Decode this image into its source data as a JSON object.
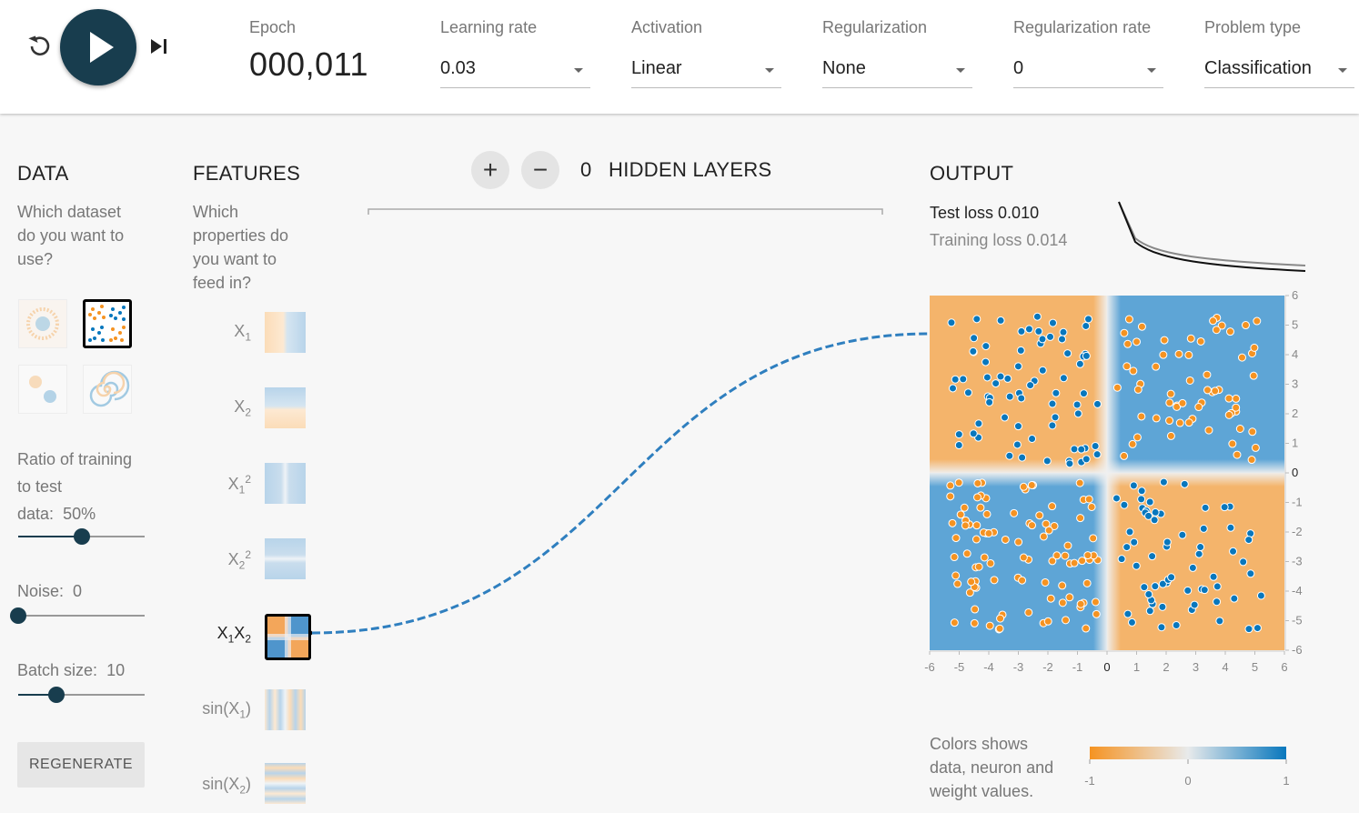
{
  "header": {
    "epoch_label": "Epoch",
    "epoch_value": "000,011",
    "controls": [
      {
        "label": "Learning rate",
        "value": "0.03"
      },
      {
        "label": "Activation",
        "value": "Linear"
      },
      {
        "label": "Regularization",
        "value": "None"
      },
      {
        "label": "Regularization rate",
        "value": "0"
      },
      {
        "label": "Problem type",
        "value": "Classification"
      }
    ]
  },
  "data_panel": {
    "title": "DATA",
    "question": [
      "Which dataset",
      "do you want to",
      "use?"
    ],
    "datasets": [
      "circle",
      "xor",
      "gaussian",
      "spiral"
    ],
    "selected_dataset": "xor",
    "ratio_label": [
      "Ratio of training",
      "to test"
    ],
    "ratio_prefix": "data:",
    "ratio_value": "50%",
    "ratio_fraction": 0.5,
    "noise_label": "Noise:",
    "noise_value": "0",
    "noise_fraction": 0,
    "batch_label": "Batch size:",
    "batch_value": "10",
    "batch_fraction": 0.3,
    "regenerate": "REGENERATE"
  },
  "features_panel": {
    "title": "FEATURES",
    "question": [
      "Which",
      "properties do",
      "you want to",
      "feed in?"
    ],
    "features": [
      {
        "id": "x1",
        "active": false
      },
      {
        "id": "x2",
        "active": false
      },
      {
        "id": "x1sq",
        "active": false
      },
      {
        "id": "x2sq",
        "active": false
      },
      {
        "id": "x1x2",
        "active": true
      },
      {
        "id": "sinx1",
        "active": false
      },
      {
        "id": "sinx2",
        "active": false
      }
    ]
  },
  "network": {
    "add_layer": "+",
    "remove_layer": "−",
    "hidden_count": "0",
    "hidden_label": "HIDDEN LAYERS"
  },
  "output_panel": {
    "title": "OUTPUT",
    "test_loss_label": "Test loss",
    "test_loss_value": "0.010",
    "train_loss_label": "Training loss",
    "train_loss_value": "0.014",
    "axis_ticks": [
      -6,
      -5,
      -4,
      -3,
      -2,
      -1,
      0,
      1,
      2,
      3,
      4,
      5,
      6
    ],
    "legend_text": [
      "Colors shows",
      "data, neuron and",
      "weight values."
    ],
    "legend_ticks": [
      "-1",
      "0",
      "1"
    ],
    "colors": {
      "orange": "#f59322",
      "blue": "#0877bd",
      "dark": "#183d4e"
    }
  }
}
